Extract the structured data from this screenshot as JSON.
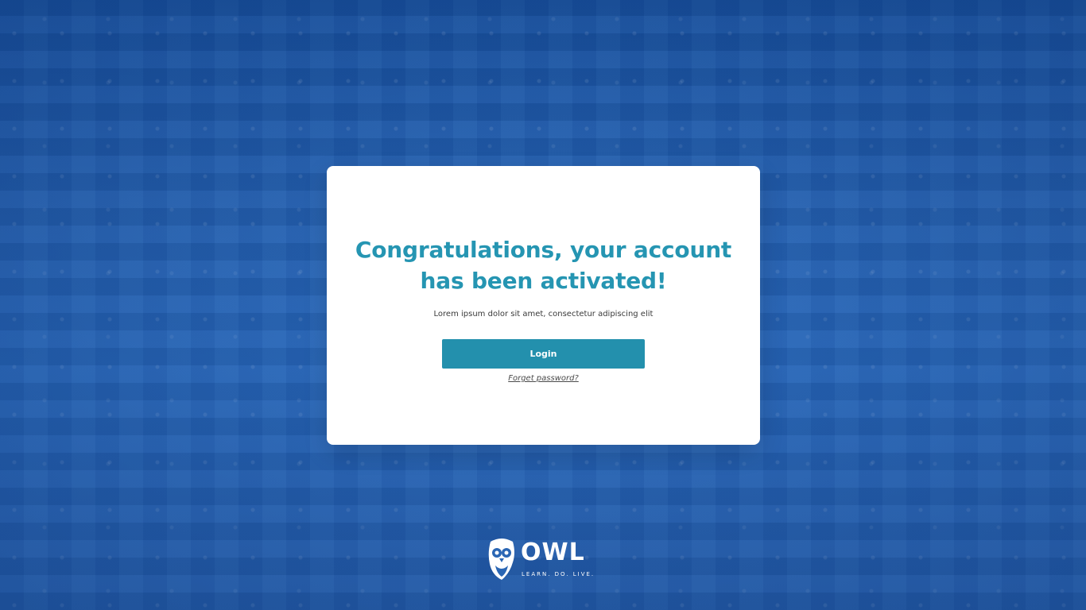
{
  "card": {
    "title_line1": "Congratulations, your account",
    "title_line2": "has been activated!",
    "subtitle": "Lorem ipsum dolor sit amet, consectetur adipiscing elit",
    "login_label": "Login",
    "forgot_label": "Forget password?"
  },
  "logo": {
    "icon": "owl-icon",
    "wordmark": "OWL",
    "tagline": "LEARN. DO. LIVE."
  },
  "colors": {
    "accent": "#2595b2",
    "button": "#2390ad",
    "background_tint": "#2a66b4"
  }
}
